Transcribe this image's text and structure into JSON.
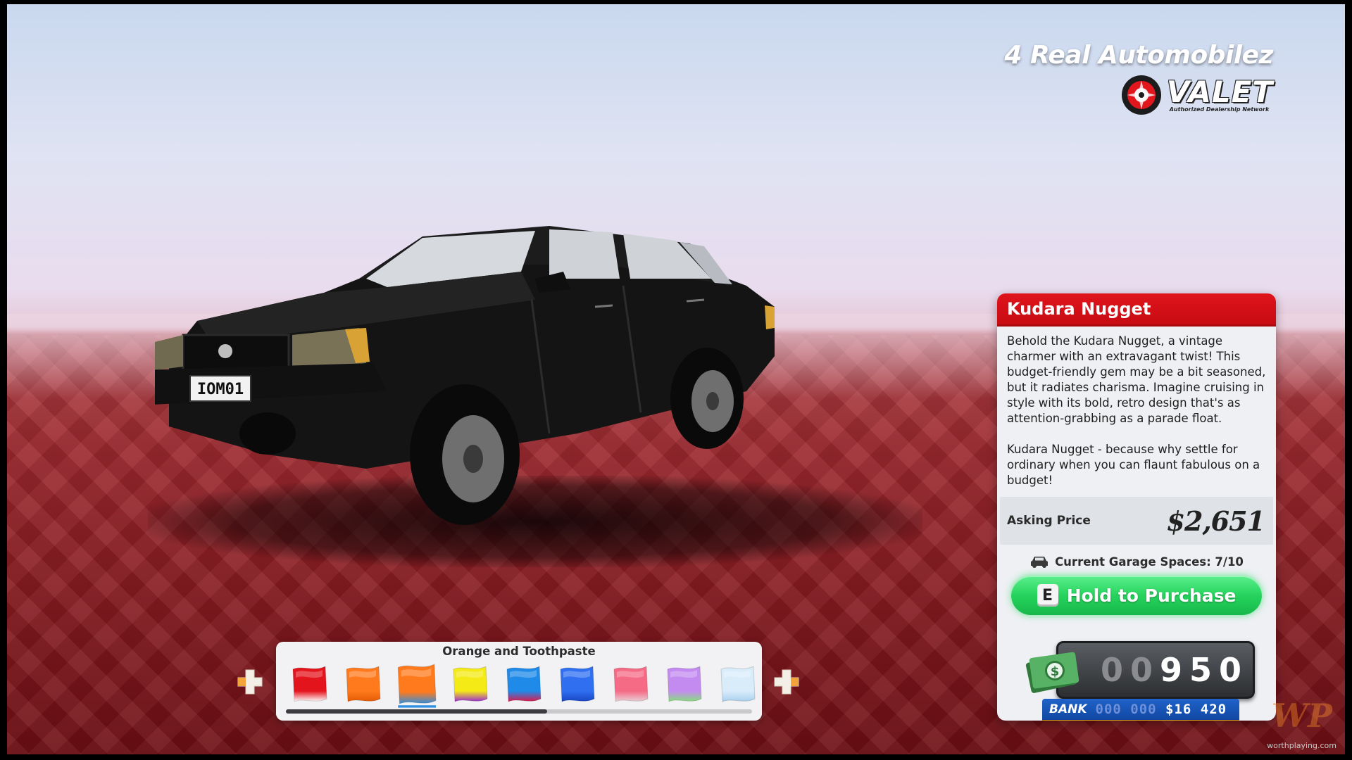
{
  "dealer": {
    "name": "4 Real Automobilez",
    "brand": "VALET",
    "tagline": "Authorized Dealership Network"
  },
  "car": {
    "plate": "IOM01"
  },
  "panel": {
    "title": "Kudara Nugget",
    "description_1": "Behold the Kudara Nugget, a vintage charmer with an extravagant twist! This budget-friendly gem may be a bit seasoned, but it radiates charisma. Imagine cruising in style with its bold, retro design that's as attention-grabbing as a parade float.",
    "description_2": "Kudara Nugget - because why settle for ordinary when you can flaunt fabulous on a budget!",
    "price_label": "Asking Price",
    "price_value": "$2,651",
    "garage_text": "Current Garage Spaces: 7/10",
    "purchase_key": "E",
    "purchase_label": "Hold to Purchase"
  },
  "wallet": {
    "counter_dim": [
      "0",
      "0"
    ],
    "counter_lit": [
      "9",
      "5",
      "0"
    ],
    "bank_label": "BANK",
    "bank_dim": "000 000",
    "bank_lit": "$16 420"
  },
  "color_picker": {
    "selected_name": "Orange and Toothpaste",
    "scroll_fraction": 0.56,
    "swatches": [
      {
        "id": "red",
        "top": "#e4141d",
        "bottom": "#ffffff"
      },
      {
        "id": "orange",
        "top": "#ff7a1c",
        "bottom": "#e35a05"
      },
      {
        "id": "orange-toothpaste",
        "top": "#ff7a1c",
        "bottom": "#2f8fe0"
      },
      {
        "id": "yellow-purple",
        "top": "#f4ea16",
        "bottom": "#9b2ad6"
      },
      {
        "id": "blue-red",
        "top": "#1f8ae8",
        "bottom": "#e0184a"
      },
      {
        "id": "sparkle-blue",
        "top": "#2f6ff0",
        "bottom": "#1846c4"
      },
      {
        "id": "pink",
        "top": "#f56b86",
        "bottom": "#e8d2d6"
      },
      {
        "id": "lilac-green",
        "top": "#c38bf0",
        "bottom": "#86e07a"
      },
      {
        "id": "ice",
        "top": "#d8ecfa",
        "bottom": "#a8cfee"
      }
    ]
  },
  "colors": {
    "panel_header": "#e0141c",
    "purchase_green": "#26d35d",
    "bank_blue": "#1148a2"
  },
  "watermark": {
    "logo": "WP",
    "site": "worthplaying.com"
  }
}
